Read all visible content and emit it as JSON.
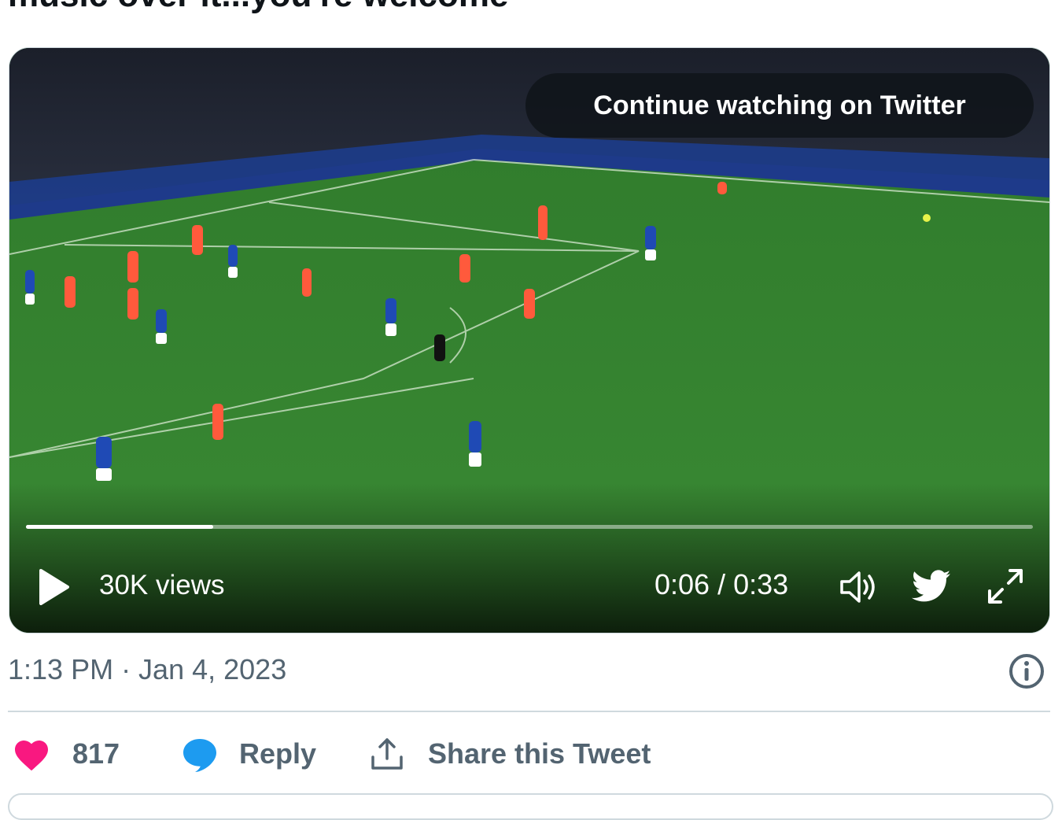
{
  "tweet": {
    "text_fragment": "music over it...you're welcome",
    "timestamp": "1:13 PM · Jan 4, 2023"
  },
  "video": {
    "overlay_button": "Continue watching on Twitter",
    "views": "30K views",
    "time": "0:06 / 0:33",
    "progress_fraction": 0.186,
    "icons": {
      "play": "play-icon",
      "volume": "volume-icon",
      "twitter": "twitter-bird-icon",
      "fullscreen": "expand-icon"
    }
  },
  "actions": {
    "like_count": "817",
    "reply_label": "Reply",
    "share_label": "Share this Tweet"
  },
  "colors": {
    "like": "#f91880",
    "reply": "#1d9bf0",
    "muted_text": "#536471"
  }
}
